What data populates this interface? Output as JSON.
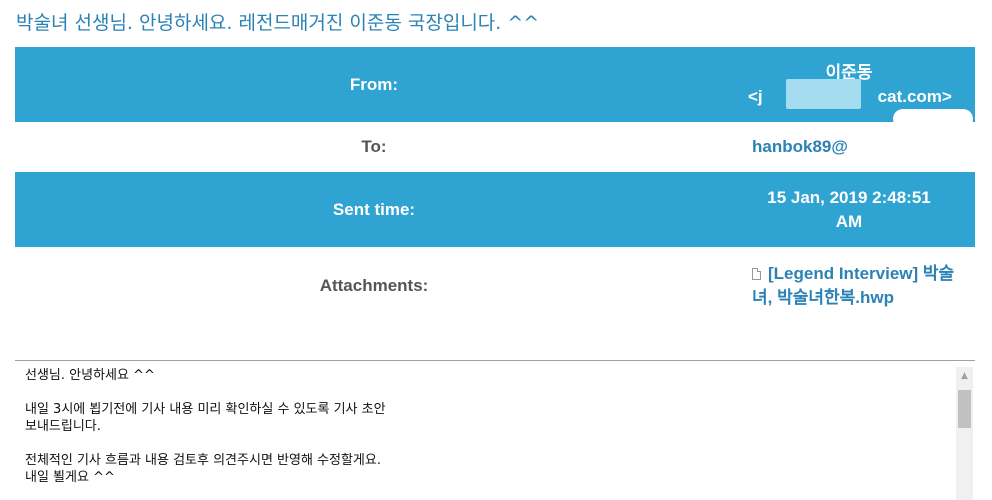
{
  "subject": "박술녀 선생님. 안녕하세요. 레전드매거진 이준동 국장입니다. ^^",
  "meta": {
    "from_label": "From:",
    "from_name": "이준동",
    "from_email": "<j",
    "from_email_tail": "cat.com>",
    "to_label": "To:",
    "to_email": "hanbok89@",
    "sent_label": "Sent time:",
    "sent_value_line1": "15 Jan, 2019 2:48:51",
    "sent_value_line2": "AM",
    "attachments_label": "Attachments:",
    "attachment_name": "[Legend Interview] 박술녀, 박술녀한복.hwp"
  },
  "body": {
    "text": "선생님. 안녕하세요 ^^\n\n내일 3시에 뵙기전에 기사 내용 미리 확인하실 수 있도록 기사 초안\n보내드립니다.\n\n전체적인 기사 흐름과 내용 검토후 의견주시면 반영해 수정할게요.\n내일 뵐게요 ^^"
  },
  "colors": {
    "header_blue": "#2fa3d1",
    "link_blue": "#2a82b5",
    "subject_blue": "#2a82b5"
  }
}
